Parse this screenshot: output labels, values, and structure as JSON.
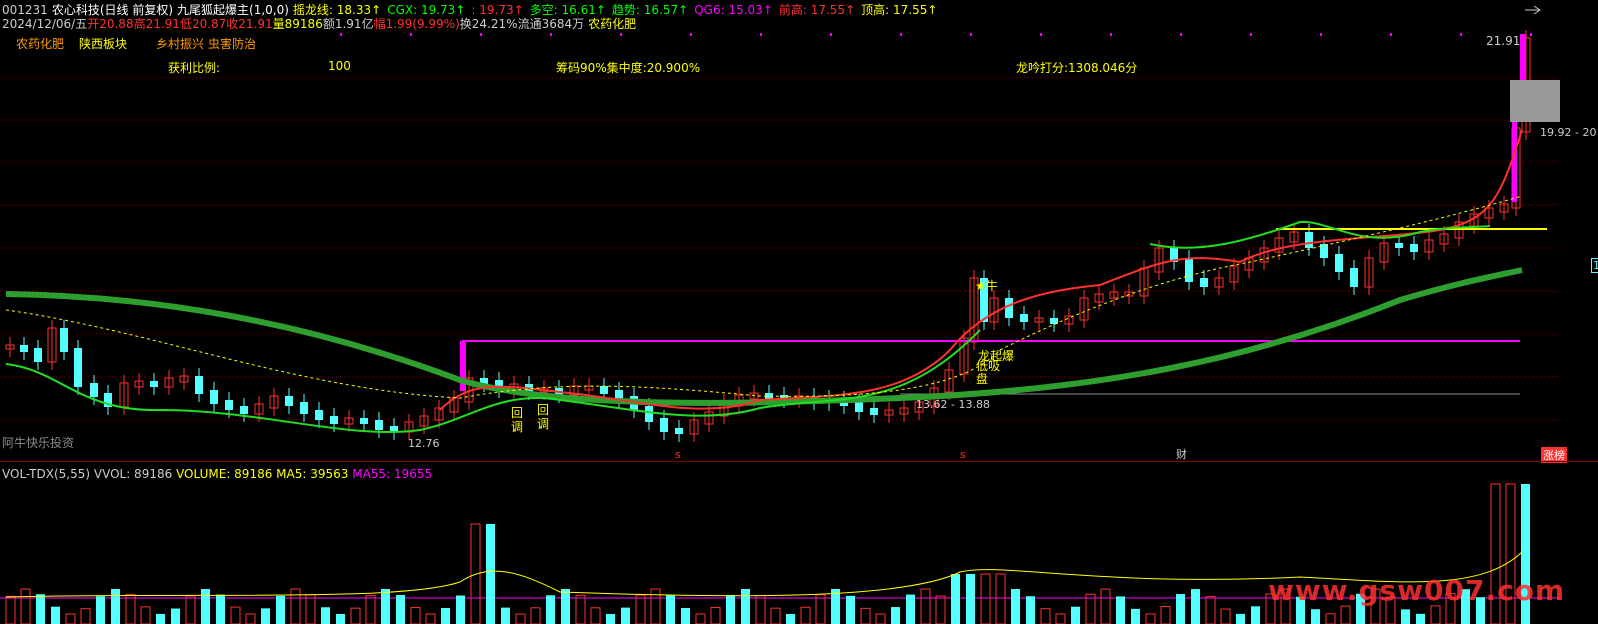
{
  "header": {
    "code": "001231",
    "name": "农心科技",
    "period": "(日线 前复权)",
    "indicator": "九尾狐起爆主(1,0,0)",
    "items": [
      {
        "label": "摇龙线:",
        "value": "18.33",
        "color": "#ffff00"
      },
      {
        "label": "CGX:",
        "value": "19.73",
        "color": "#00ff00"
      },
      {
        "label": ":",
        "value": "19.73",
        "color": "#ff3030"
      },
      {
        "label": "多空:",
        "value": "16.61",
        "color": "#00ff00"
      },
      {
        "label": "趋势:",
        "value": "16.57",
        "color": "#00ff00"
      },
      {
        "label": "QG6:",
        "value": "15.03",
        "color": "#ff00ff"
      },
      {
        "label": "前高:",
        "value": "17.55",
        "color": "#ff3030"
      },
      {
        "label": "顶高:",
        "value": "17.55",
        "color": "#ffff00"
      }
    ]
  },
  "quote": {
    "date": "2024/12/06/五",
    "open": "开20.88",
    "high": "高21.91",
    "low": "低20.87",
    "close": "收21.91",
    "volume": "量89186",
    "amount": "额1.91亿",
    "change": "幅1.99(9.99%)",
    "turnover": "换24.21%",
    "float": "流通3684万",
    "sector": "农药化肥"
  },
  "tags": [
    "农药化肥",
    "陕西板块",
    "乡村振兴",
    "虫害防治"
  ],
  "stats": {
    "profit_label": "获利比例:",
    "profit_value": "100",
    "chip": "筹码90%集中度:20.900%",
    "score": "龙吟打分:1308.046分"
  },
  "annotations": {
    "price_top": "21.91",
    "price_range": "19.92 - 20",
    "low_label": "12.76",
    "mid_label": "13.62 - 13.88",
    "watermark_left": "阿牛快乐投资",
    "pullback1": "回调",
    "pullback2": "回调",
    "star_bull": "★牛",
    "dragon": "龙起爆",
    "stop": "低吸盘",
    "marker_s1": "s",
    "marker_s2": "s",
    "marker_cai": "财",
    "marker_zt": "涨榜",
    "right_edge": "1"
  },
  "volume_panel": {
    "name": "VOL-TDX(5,55)",
    "vvol": "VVOL: 89186",
    "volume": "VOLUME: 89186",
    "ma5": "MA5: 39563",
    "ma55": "MA55: 19655",
    "watermark": "www.gsw007.com"
  },
  "colors": {
    "up": "#ff3030",
    "down": "#54ffff",
    "green_line": "#2e9e2e",
    "magenta": "#ff00ff",
    "yellow": "#ffff00",
    "grid": "#7a0000"
  }
}
